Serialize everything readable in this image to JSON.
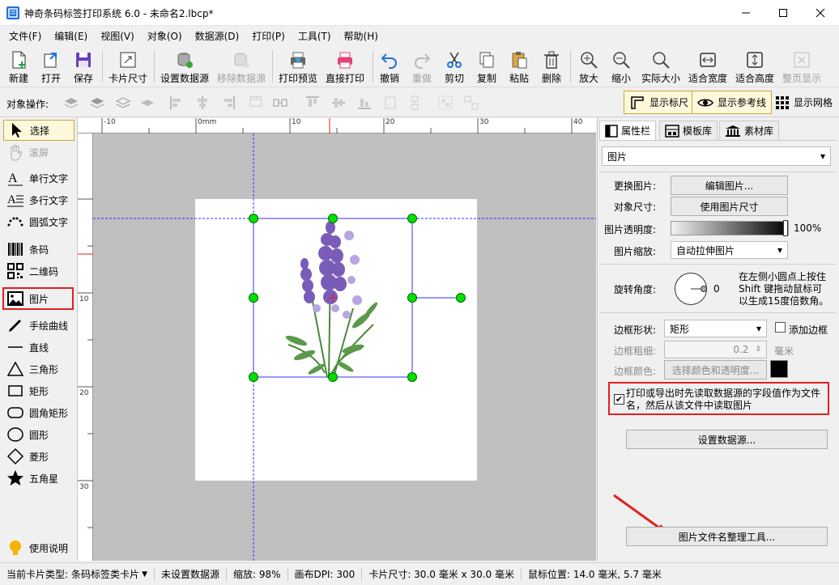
{
  "window": {
    "title": "神奇条码标签打印系统 6.0 - 未命名2.lbcp*",
    "minimize_icon": "minimize-icon",
    "maximize_icon": "maximize-icon",
    "close_icon": "close-icon"
  },
  "menu": [
    "文件(F)",
    "编辑(E)",
    "视图(V)",
    "对象(O)",
    "数据源(D)",
    "打印(P)",
    "工具(T)",
    "帮助(H)"
  ],
  "toolbar": [
    {
      "label": "新建",
      "icon": "new-file-icon",
      "enabled": true
    },
    {
      "label": "打开",
      "icon": "open-icon",
      "enabled": true
    },
    {
      "label": "保存",
      "icon": "save-icon",
      "enabled": true
    },
    {
      "label": "卡片尺寸",
      "icon": "card-size-icon",
      "enabled": true
    },
    {
      "label": "设置数据源",
      "icon": "database-icon",
      "enabled": true
    },
    {
      "label": "移除数据源",
      "icon": "database-remove-icon",
      "enabled": false
    },
    {
      "label": "打印预览",
      "icon": "print-preview-icon",
      "enabled": true
    },
    {
      "label": "直接打印",
      "icon": "printer-icon",
      "enabled": true
    },
    {
      "label": "撤销",
      "icon": "undo-icon",
      "enabled": true
    },
    {
      "label": "重做",
      "icon": "redo-icon",
      "enabled": false
    },
    {
      "label": "剪切",
      "icon": "scissors-icon",
      "enabled": true
    },
    {
      "label": "复制",
      "icon": "copy-icon",
      "enabled": true
    },
    {
      "label": "粘贴",
      "icon": "paste-icon",
      "enabled": true
    },
    {
      "label": "删除",
      "icon": "trash-icon",
      "enabled": true
    },
    {
      "label": "放大",
      "icon": "zoom-in-icon",
      "enabled": true
    },
    {
      "label": "缩小",
      "icon": "zoom-out-icon",
      "enabled": true
    },
    {
      "label": "实际大小",
      "icon": "zoom-actual-icon",
      "enabled": true
    },
    {
      "label": "适合宽度",
      "icon": "fit-width-icon",
      "enabled": true
    },
    {
      "label": "适合高度",
      "icon": "fit-height-icon",
      "enabled": true
    },
    {
      "label": "整页显示",
      "icon": "fit-page-icon",
      "enabled": false
    }
  ],
  "objbar": {
    "label": "对象操作:",
    "show_ruler": "显示标尺",
    "show_guides": "显示参考线",
    "show_grid": "显示网格"
  },
  "left_tools": [
    {
      "label": "选择",
      "icon": "pointer-icon",
      "selected": true,
      "enabled": true
    },
    {
      "label": "滚屏",
      "icon": "hand-icon",
      "selected": false,
      "enabled": false
    },
    {
      "label": "单行文字",
      "icon": "single-line-text-icon",
      "selected": false,
      "enabled": true
    },
    {
      "label": "多行文字",
      "icon": "multi-line-text-icon",
      "selected": false,
      "enabled": true
    },
    {
      "label": "圆弧文字",
      "icon": "arc-text-icon",
      "selected": false,
      "enabled": true
    },
    {
      "label": "条码",
      "icon": "barcode-icon",
      "selected": false,
      "enabled": true
    },
    {
      "label": "二维码",
      "icon": "qrcode-icon",
      "selected": false,
      "enabled": true
    },
    {
      "label": "图片",
      "icon": "image-icon",
      "selected": false,
      "enabled": true
    },
    {
      "label": "手绘曲线",
      "icon": "pen-icon",
      "selected": false,
      "enabled": true
    },
    {
      "label": "直线",
      "icon": "line-icon",
      "selected": false,
      "enabled": true
    },
    {
      "label": "三角形",
      "icon": "triangle-icon",
      "selected": false,
      "enabled": true
    },
    {
      "label": "矩形",
      "icon": "rectangle-icon",
      "selected": false,
      "enabled": true
    },
    {
      "label": "圆角矩形",
      "icon": "rounded-rectangle-icon",
      "selected": false,
      "enabled": true
    },
    {
      "label": "圆形",
      "icon": "circle-icon",
      "selected": false,
      "enabled": true
    },
    {
      "label": "菱形",
      "icon": "diamond-icon",
      "selected": false,
      "enabled": true
    },
    {
      "label": "五角星",
      "icon": "star-icon",
      "selected": false,
      "enabled": true
    }
  ],
  "help_label": "使用说明",
  "ruler": {
    "top": [
      "-10",
      "0mm",
      "10",
      "20",
      "30",
      "40"
    ],
    "left": [
      "10",
      "20",
      "30"
    ]
  },
  "right_panel": {
    "tabs": [
      "属性栏",
      "模板库",
      "素材库"
    ],
    "object_type": "图片",
    "change_image_label": "更换图片:",
    "edit_image_btn": "编辑图片...",
    "object_size_label": "对象尺寸:",
    "use_image_size_btn": "使用图片尺寸",
    "opacity_label": "图片透明度:",
    "opacity_value": "100%",
    "opacity_level": 1.0,
    "scaling_label": "图片缩放:",
    "scaling_value": "自动拉伸图片",
    "rotation_label": "旋转角度:",
    "rotation_value": "0",
    "rotation_hint": [
      "在左侧小圆点上按住",
      "Shift 键拖动鼠标可",
      "以生成15度倍数角。"
    ],
    "border_shape_label": "边框形状:",
    "border_shape_value": "矩形",
    "add_border_label": "添加边框",
    "add_border_checked": false,
    "border_width_label": "边框粗细:",
    "border_width_value": "0.2",
    "border_width_unit": "毫米",
    "border_color_label": "边框颜色:",
    "border_color_btn": "选择颜色和透明度...",
    "border_color_value": "#000000",
    "read_datasource_label": [
      "打印或导出时先读取数据源的字段值作为文件",
      "名，然后从该文件中读取图片"
    ],
    "read_datasource_checked": true,
    "set_datasource_btn": "设置数据源...",
    "filename_tool_btn": "图片文件名整理工具..."
  },
  "status": {
    "card_type_label": "当前卡片类型:",
    "card_type_value": "条码标签类卡片",
    "datasource": "未设置数据源",
    "zoom": "缩放: 98%",
    "dpi": "画布DPI: 300",
    "card_size": "卡片尺寸: 30.0 毫米 x 30.0 毫米",
    "mouse_pos": "鼠标位置: 14.0 毫米, 5.7 毫米"
  },
  "colors": {
    "highlight_red": "#e02020",
    "handle_green": "#00e000",
    "guide_blue": "#3030ff",
    "selected_tool_bg": "#fff8dc"
  }
}
